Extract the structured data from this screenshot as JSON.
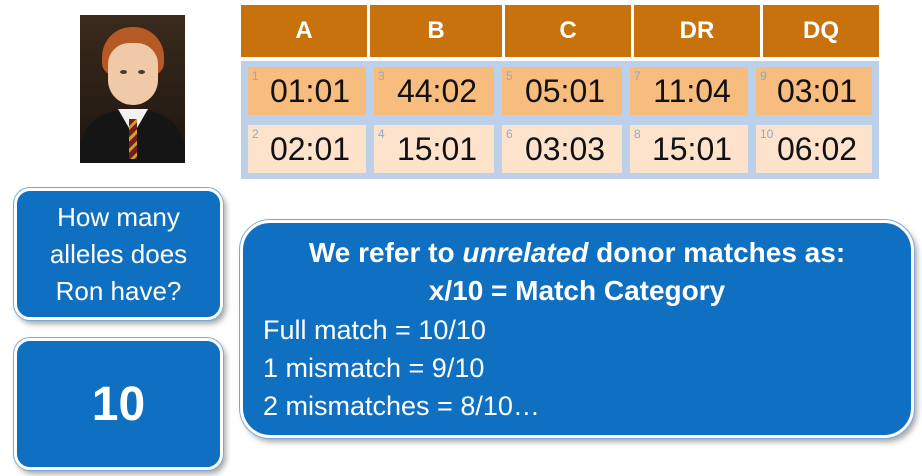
{
  "photo": {
    "alt": "Ron"
  },
  "table": {
    "headers": [
      "A",
      "B",
      "C",
      "DR",
      "DQ"
    ],
    "rows": [
      [
        {
          "num": "1",
          "val": "01:01"
        },
        {
          "num": "3",
          "val": "44:02"
        },
        {
          "num": "5",
          "val": "05:01"
        },
        {
          "num": "7",
          "val": "11:04"
        },
        {
          "num": "9",
          "val": "03:01"
        }
      ],
      [
        {
          "num": "2",
          "val": "02:01"
        },
        {
          "num": "4",
          "val": "15:01"
        },
        {
          "num": "6",
          "val": "03:03"
        },
        {
          "num": "8",
          "val": "15:01"
        },
        {
          "num": "10",
          "val": "06:02"
        }
      ]
    ]
  },
  "question": {
    "line1": "How many",
    "line2": "alleles does",
    "line3": "Ron have?"
  },
  "answer": {
    "text": "10"
  },
  "info": {
    "line1_pre": "We refer to ",
    "line1_em": "unrelated",
    "line1_post": " donor matches as:",
    "line2": "x/10 = Match Category",
    "line3": "Full match = 10/10",
    "line4": "1 mismatch = 9/10",
    "line5": "2 mismatches = 8/10…"
  },
  "colors": {
    "header": "#c8720d",
    "row1": "#f6bd7e",
    "row2": "#fde3cc",
    "box": "#0f6fc0"
  }
}
